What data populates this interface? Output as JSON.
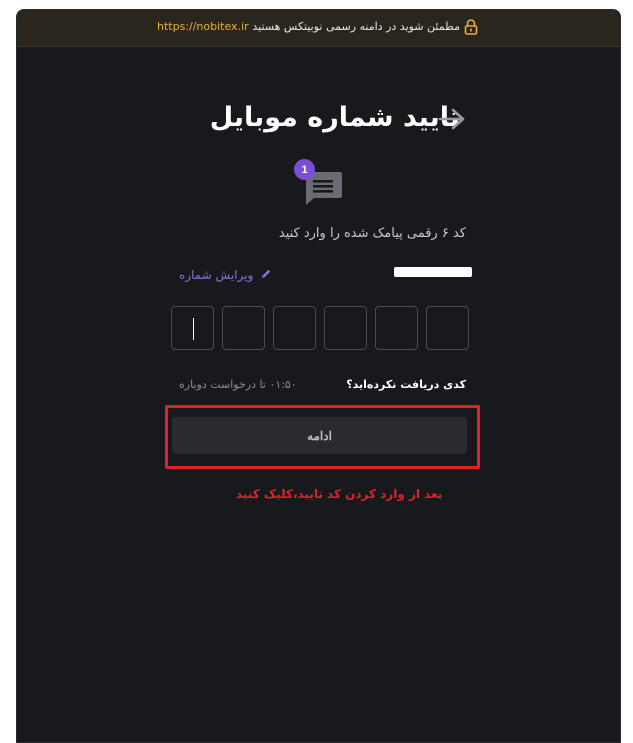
{
  "banner": {
    "url": "https://nobitex.ir",
    "notice": "مطمئن شوید در دامنه رسمی نوبیتکس هستید"
  },
  "header": {
    "title": "تایید شماره موبایل"
  },
  "sms": {
    "badge_count": "1",
    "instruction": "کد ۶ رقمی پیامک شده را وارد کنید"
  },
  "phone": {
    "edit_label": "ویرایش شماره"
  },
  "otp": {
    "digits": [
      "",
      "",
      "",
      "",
      "",
      ""
    ]
  },
  "resend": {
    "question": "کدی دریافت نکرده‌اید؟",
    "timer": "۰۱:۵۰ تا درخواست دوباره"
  },
  "actions": {
    "continue_label": "ادامه"
  },
  "annotation": {
    "text": "بعد از وارد کردن کد تایید،کلیک کنید"
  },
  "colors": {
    "background": "#18191d",
    "banner": "#2b261d",
    "accent": "#8d6ddb",
    "warning_url": "#e8b23a",
    "annotation_red": "#e0202a"
  }
}
